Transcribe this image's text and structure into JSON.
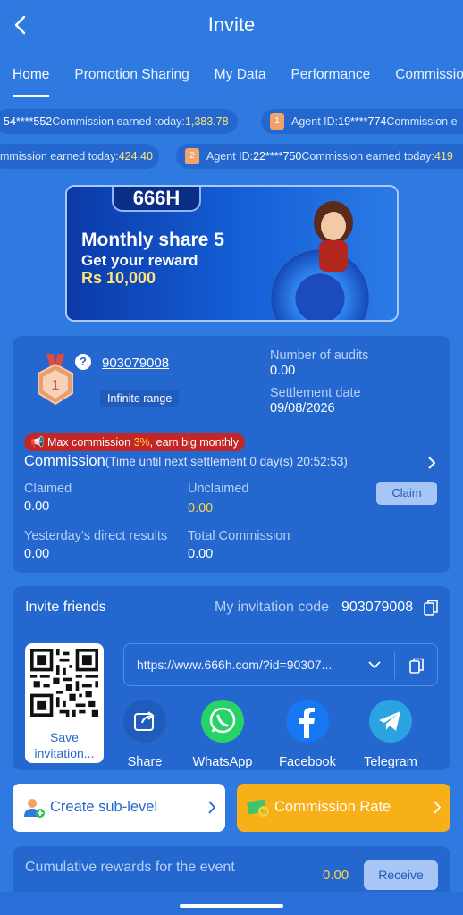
{
  "header": {
    "title": "Invite"
  },
  "tabs": [
    "Home",
    "Promotion Sharing",
    "My Data",
    "Performance",
    "Commission"
  ],
  "ticker": {
    "row1_a": {
      "prefix": "54****552",
      "label": " Commission earned today: ",
      "amount": "1,383.78"
    },
    "row1_b": {
      "rank": "1",
      "agent_label": "Agent ID: ",
      "agent_id": "19****774",
      "label": " Commission e"
    },
    "row2_a": {
      "label": "mmission earned today: ",
      "amount": "424.40"
    },
    "row2_b": {
      "rank": "2",
      "agent_label": "Agent ID: ",
      "agent_id": "22****750",
      "label": " Commission earned today: ",
      "amount": "419"
    }
  },
  "banner": {
    "logo": "666H",
    "line1": "Monthly share 5",
    "line2": "Get your reward",
    "line3": "Rs 10,000"
  },
  "account": {
    "rank": "1",
    "user_id": "903079008",
    "range": "Infinite range",
    "audits_label": "Number of audits",
    "audits_value": "0.00",
    "settlement_label": "Settlement date",
    "settlement_value": "09/08/2026",
    "max_commission_prefix": "📢 Max commission ",
    "max_commission_rate": "3%",
    "max_commission_suffix": ", earn big monthly",
    "commission_title": "Commission",
    "commission_timer": "(Time until next settlement  0 day(s) 20:52:53)",
    "claimed_label": "Claimed",
    "claimed_value": "0.00",
    "unclaimed_label": "Unclaimed",
    "unclaimed_value": "0.00",
    "claim_button": "Claim",
    "yesterday_label": "Yesterday's direct results",
    "yesterday_value": "0.00",
    "total_label": "Total Commission",
    "total_value": "0.00"
  },
  "invite": {
    "title": "Invite friends",
    "code_label": "My invitation code",
    "code_value": "903079008",
    "save_label": "Save invitation...",
    "link": "https://www.666h.com/?id=90307...",
    "share_items": [
      {
        "label": "Share",
        "icon": "share-icon"
      },
      {
        "label": "WhatsApp",
        "icon": "whatsapp-icon"
      },
      {
        "label": "Facebook",
        "icon": "facebook-icon"
      },
      {
        "label": "Telegram",
        "icon": "telegram-icon"
      }
    ]
  },
  "actions": {
    "sub_level": "Create sub-level",
    "commission_rate": "Commission Rate"
  },
  "event": {
    "label": "Cumulative rewards for the event",
    "value": "0.00",
    "receive": "Receive"
  },
  "colors": {
    "background": "#2f7ae0",
    "card": "#2468cf",
    "highlight": "#ffd04a",
    "rate_button": "#f8b018"
  }
}
